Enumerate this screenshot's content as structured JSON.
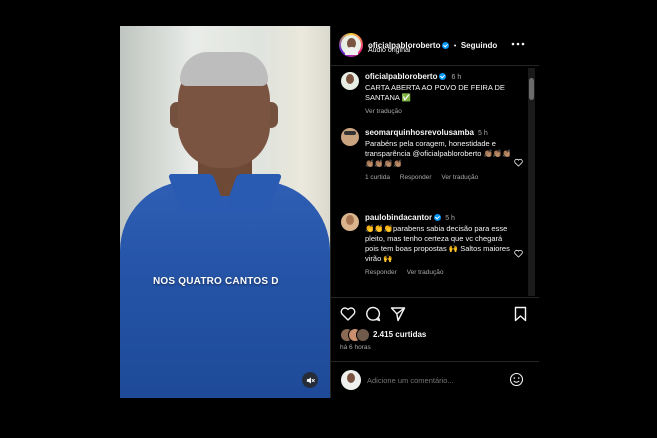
{
  "video": {
    "caption": "NOS QUATRO CANTOS D"
  },
  "header": {
    "username": "oficialpabloroberto",
    "follow_status": "Seguindo",
    "separator": "•",
    "subtitle": "Áudio original"
  },
  "caption_post": {
    "username": "oficialpabloroberto",
    "time": "6 h",
    "text": "CARTA ABERTA AO POVO DE FEIRA DE SANTANA ✅",
    "translate": "Ver tradução"
  },
  "comments": [
    {
      "username": "seomarquinhosrevolusamba",
      "time": "5 h",
      "text": "Parabéns pela coragem, honestidade e transparência @oficialpabloroberto 👏🏽👏🏽👏🏽👏🏽👏🏽👏🏽👏🏽",
      "likes": "1 curtida",
      "reply": "Responder",
      "translate": "Ver tradução"
    },
    {
      "username": "paulobindacantor",
      "time": "5 h",
      "text": "👏👏👏parabens sabia decisão para esse pleito, mas tenho certeza que vc chegará pois tem boas propostas 🙌 Saltos maiores virão 🙌",
      "reply": "Responder",
      "translate": "Ver tradução"
    }
  ],
  "post": {
    "likes_count": "2.415 curtidas",
    "time_ago": "há 6 horas",
    "comment_placeholder": "Adicione um comentário..."
  },
  "colors": {
    "verified": "#0095f6",
    "background": "#000000",
    "muted_text": "#a8a8a8",
    "shirt": "#2554a8"
  }
}
